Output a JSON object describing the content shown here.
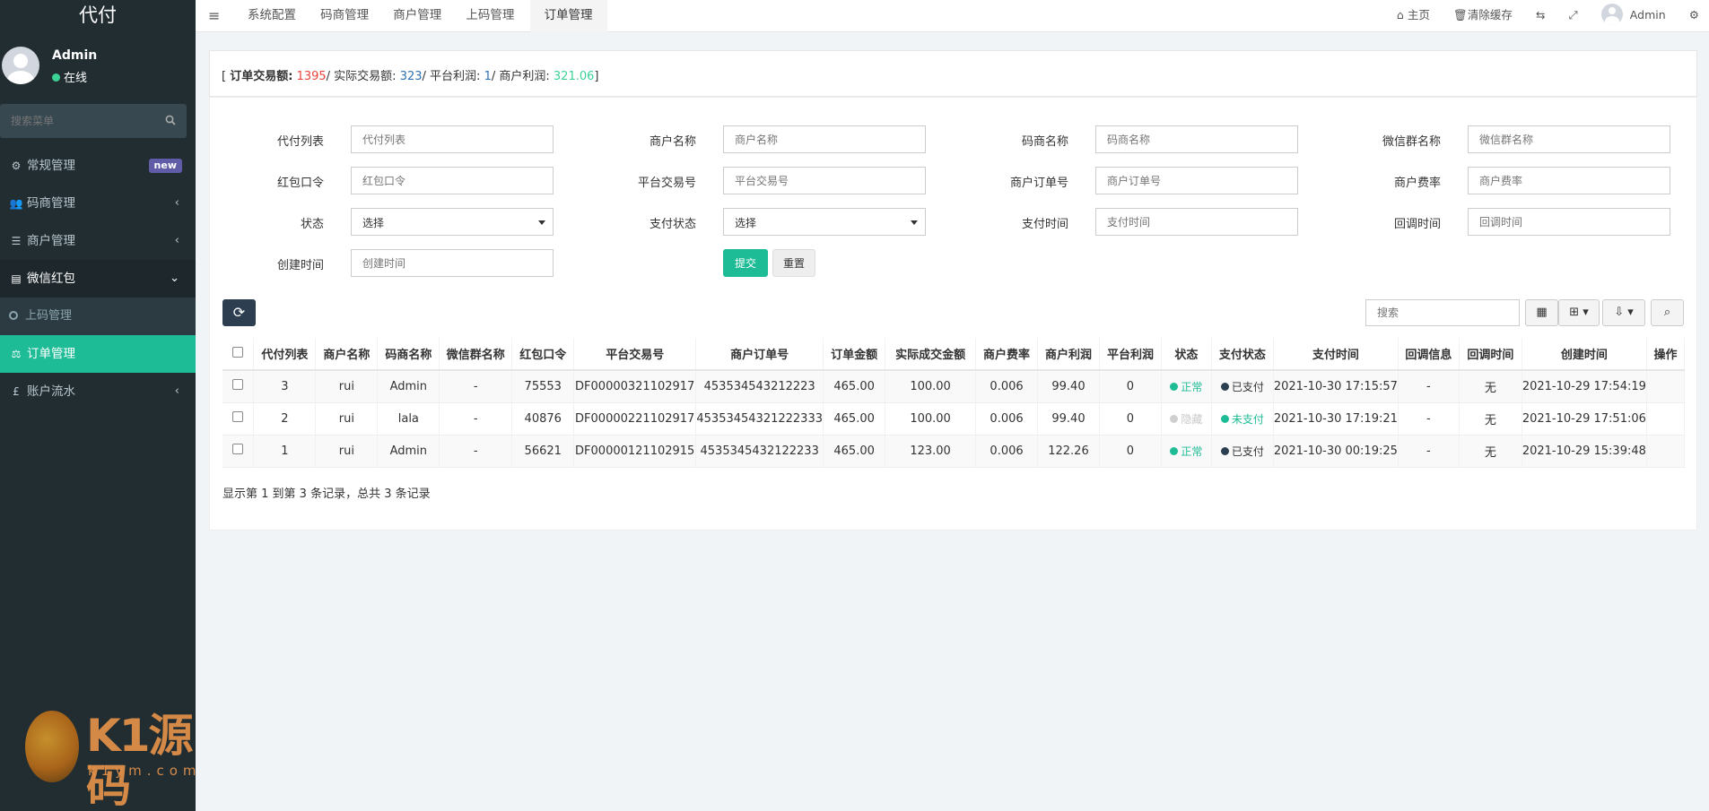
{
  "app": {
    "title": "代付"
  },
  "user": {
    "name": "Admin",
    "status": "在线"
  },
  "sidebar": {
    "search_placeholder": "搜索菜单",
    "items": [
      {
        "label": "常规管理",
        "icon": "gears-icon",
        "badge": "new"
      },
      {
        "label": "码商管理",
        "icon": "users-icon",
        "arrow": "‹"
      },
      {
        "label": "商户管理",
        "icon": "list-icon",
        "arrow": "‹"
      },
      {
        "label": "微信红包",
        "icon": "database-icon",
        "arrow": "⌄"
      },
      {
        "label": "上码管理",
        "icon": "circle-icon"
      },
      {
        "label": "订单管理",
        "icon": "balance-icon"
      },
      {
        "label": "账户流水",
        "icon": "pound-icon",
        "arrow": "‹"
      }
    ]
  },
  "watermark": {
    "text": "K1源码",
    "sub": "k1ym.com"
  },
  "topnav": {
    "tabs": [
      "系统配置",
      "码商管理",
      "商户管理",
      "上码管理",
      "订单管理"
    ],
    "right": {
      "home": "主页",
      "clear_cache": "清除缓存",
      "user": "Admin"
    }
  },
  "summary": {
    "label_total": "订单交易额:",
    "total": "1395",
    "label_actual": "/ 实际交易额:",
    "actual": "323",
    "label_platform": "/ 平台利润:",
    "platform": "1",
    "label_merchant": "/ 商户利润:",
    "merchant": "321.06"
  },
  "filters": {
    "f1": {
      "label": "代付列表",
      "placeholder": "代付列表"
    },
    "f2": {
      "label": "商户名称",
      "placeholder": "商户名称"
    },
    "f3": {
      "label": "码商名称",
      "placeholder": "码商名称"
    },
    "f4": {
      "label": "微信群名称",
      "placeholder": "微信群名称"
    },
    "f5": {
      "label": "红包口令",
      "placeholder": "红包口令"
    },
    "f6": {
      "label": "平台交易号",
      "placeholder": "平台交易号"
    },
    "f7": {
      "label": "商户订单号",
      "placeholder": "商户订单号"
    },
    "f8": {
      "label": "商户费率",
      "placeholder": "商户费率"
    },
    "f9": {
      "label": "状态",
      "value": "选择"
    },
    "f10": {
      "label": "支付状态",
      "value": "选择"
    },
    "f11": {
      "label": "支付时间",
      "placeholder": "支付时间"
    },
    "f12": {
      "label": "回调时间",
      "placeholder": "回调时间"
    },
    "f13": {
      "label": "创建时间",
      "placeholder": "创建时间"
    },
    "submit": "提交",
    "reset": "重置"
  },
  "toolbar": {
    "search_placeholder": "搜索"
  },
  "table": {
    "headers": [
      "代付列表",
      "商户名称",
      "码商名称",
      "微信群名称",
      "红包口令",
      "平台交易号",
      "商户订单号",
      "订单金额",
      "实际成交金额",
      "商户费率",
      "商户利润",
      "平台利润",
      "状态",
      "支付状态",
      "支付时间",
      "回调信息",
      "回调时间",
      "创建时间",
      "操作"
    ],
    "rows": [
      {
        "id": "3",
        "merchant": "rui",
        "coder": "Admin",
        "group": "-",
        "code": "75553",
        "platform_no": "DF00000321102917",
        "order_no": "453534543212223",
        "amount": "465.00",
        "actual": "100.00",
        "rate": "0.006",
        "m_profit": "99.40",
        "p_profit": "0",
        "status": "正常",
        "pay_status": "已支付",
        "pay_time": "2021-10-30 17:15:57",
        "cb_info": "-",
        "cb_time": "无",
        "created": "2021-10-29 17:54:19"
      },
      {
        "id": "2",
        "merchant": "rui",
        "coder": "lala",
        "group": "-",
        "code": "40876",
        "platform_no": "DF00000221102917",
        "order_no": "45353454321222333",
        "amount": "465.00",
        "actual": "100.00",
        "rate": "0.006",
        "m_profit": "99.40",
        "p_profit": "0",
        "status": "隐藏",
        "pay_status": "未支付",
        "pay_time": "2021-10-30 17:19:21",
        "cb_info": "-",
        "cb_time": "无",
        "created": "2021-10-29 17:51:06"
      },
      {
        "id": "1",
        "merchant": "rui",
        "coder": "Admin",
        "group": "-",
        "code": "56621",
        "platform_no": "DF00000121102915",
        "order_no": "4535345432122233",
        "amount": "465.00",
        "actual": "123.00",
        "rate": "0.006",
        "m_profit": "122.26",
        "p_profit": "0",
        "status": "正常",
        "pay_status": "已支付",
        "pay_time": "2021-10-30 00:19:25",
        "cb_info": "-",
        "cb_time": "无",
        "created": "2021-10-29 15:39:48"
      }
    ],
    "footer": "显示第 1 到第 3 条记录，总共 3 条记录"
  }
}
